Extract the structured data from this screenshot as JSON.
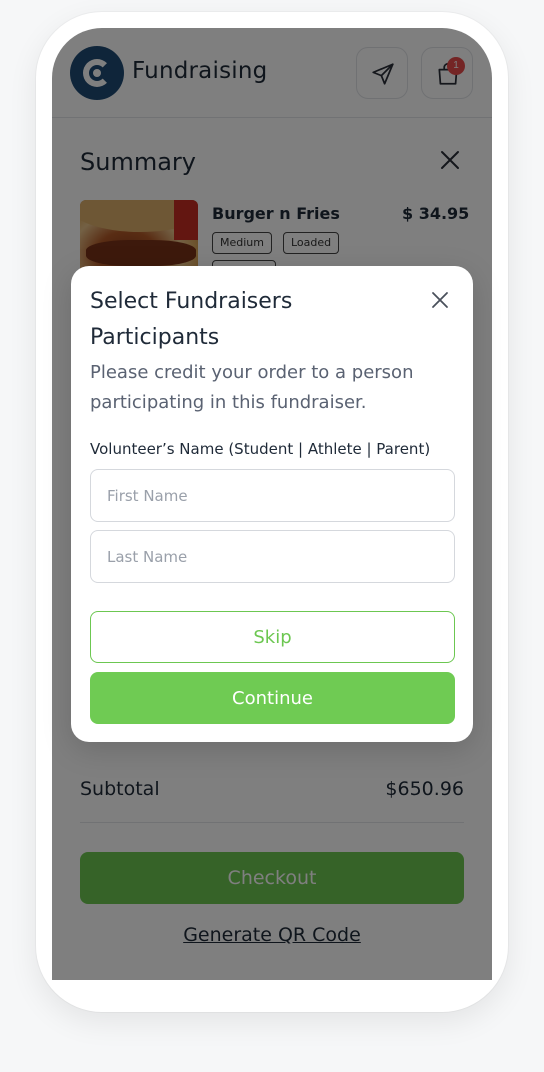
{
  "header": {
    "brand": "Fundraising",
    "cart_count": "1"
  },
  "summary": {
    "title": "Summary",
    "product": {
      "name": "Burger n Fries",
      "price": "$ 34.95",
      "tags": [
        "Medium",
        "Loaded"
      ]
    },
    "subtotal_label": "Subtotal",
    "subtotal_value": "$650.96",
    "checkout_label": "Checkout",
    "qr_label": "Generate QR Code"
  },
  "modal": {
    "title": "Select Fundraisers Participants",
    "description": "Please credit your order to a person participating in this fundraiser.",
    "field_label": "Volunteer’s Name (Student | Athlete | Parent)",
    "first_name_placeholder": "First Name",
    "last_name_placeholder": "Last Name",
    "skip_label": "Skip",
    "continue_label": "Continue"
  },
  "colors": {
    "accent_green": "#6fcb53",
    "brand_navy": "#1f4b74",
    "badge_red": "#e84b4b"
  },
  "icons": {
    "logo": "brand-logo-icon",
    "send": "send-icon",
    "cart": "shopping-bag-icon",
    "close": "close-icon"
  }
}
